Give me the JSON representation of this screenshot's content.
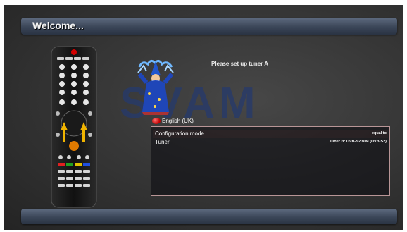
{
  "header": {
    "title": "Welcome..."
  },
  "wizard": {
    "prompt": "Please set up tuner A"
  },
  "logo": {
    "text": "SVAM"
  },
  "language": {
    "label": "English (UK)"
  },
  "config_list": {
    "rows": [
      {
        "label": "Configuration mode",
        "value": "equal to",
        "selected": true
      },
      {
        "label": "Tuner",
        "value": "Tuner B: DVB-S2 NIM (DVB-S2)",
        "selected": false
      }
    ]
  },
  "colors": {
    "title_bar": "#3b4658",
    "list_border": "#b89596",
    "selection_line": "#b98640",
    "logo": "#263a6c"
  }
}
